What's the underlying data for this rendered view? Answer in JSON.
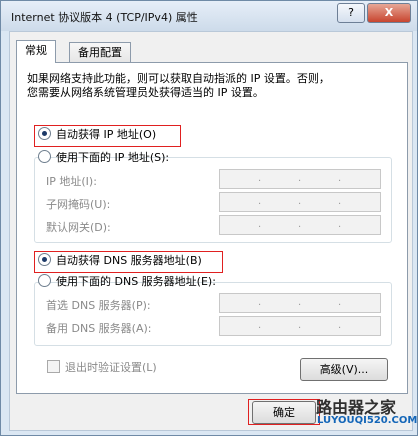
{
  "window": {
    "title": "Internet 协议版本 4 (TCP/IPv4) 属性",
    "help_label": "?",
    "close_label": "X"
  },
  "tabs": [
    {
      "label": "常规"
    },
    {
      "label": "备用配置"
    }
  ],
  "description": [
    "如果网络支持此功能，则可以获取自动指派的 IP 设置。否则，",
    "您需要从网络系统管理员处获得适当的 IP 设置。"
  ],
  "ip": {
    "auto_label": "自动获得 IP 地址(O)",
    "manual_label": "使用下面的 IP 地址(S):",
    "fields": [
      {
        "label": "IP 地址(I):"
      },
      {
        "label": "子网掩码(U):"
      },
      {
        "label": "默认网关(D):"
      }
    ]
  },
  "dns": {
    "auto_label": "自动获得 DNS 服务器地址(B)",
    "manual_label": "使用下面的 DNS 服务器地址(E):",
    "fields": [
      {
        "label": "首选 DNS 服务器(P):"
      },
      {
        "label": "备用 DNS 服务器(A):"
      }
    ]
  },
  "validate_label": "退出时验证设置(L)",
  "buttons": {
    "advanced": "高级(V)...",
    "ok": "确定"
  },
  "watermark": {
    "name": "路由器之家",
    "url": "LUYOUQI520.COM"
  }
}
